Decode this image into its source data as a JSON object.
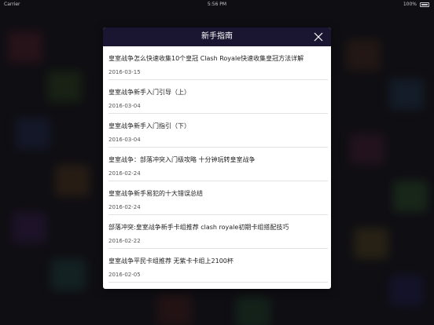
{
  "status_bar": {
    "carrier": "Carrier",
    "time": "5:56 PM",
    "battery": "100%"
  },
  "modal": {
    "title": "新手指南",
    "close_icon": "close-icon",
    "header_color": "#1a1530"
  },
  "articles": [
    {
      "title": "皇室战争怎么快速收集10个皇冠 Clash Royale快速收集皇冠方法详解",
      "date": "2016-03-15"
    },
    {
      "title": "皇室战争新手入门引导（上）",
      "date": "2016-03-04"
    },
    {
      "title": "皇室战争新手入门指引（下）",
      "date": "2016-03-04"
    },
    {
      "title": "皇室战争：部落冲突入门级攻略 十分钟玩转皇室战争",
      "date": "2016-02-24"
    },
    {
      "title": "皇室战争新手易犯的十大错误总结",
      "date": "2016-02-24"
    },
    {
      "title": "部落冲突:皇室战争新手卡组推荐 clash royale初期卡组搭配技巧",
      "date": "2016-02-22"
    },
    {
      "title": "皇室战争平民卡组推荐 无紫卡卡组上2100杯",
      "date": "2016-02-05"
    }
  ]
}
